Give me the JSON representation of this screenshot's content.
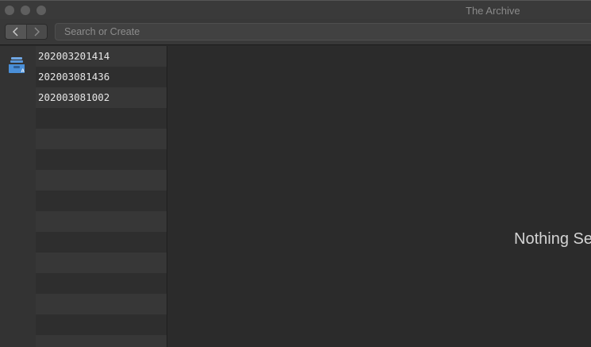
{
  "window": {
    "title": "The Archive"
  },
  "toolbar": {
    "back_icon": "chevron-left-icon",
    "forward_icon": "chevron-right-icon",
    "search_placeholder": "Search or Create",
    "search_value": ""
  },
  "sidebar": {
    "icon": "archive-tray-icon",
    "accent_color": "#4a8fd8"
  },
  "notes": [
    {
      "title": "202003201414"
    },
    {
      "title": "202003081436"
    },
    {
      "title": "202003081002"
    }
  ],
  "editor": {
    "empty_message": "Nothing Selected"
  }
}
